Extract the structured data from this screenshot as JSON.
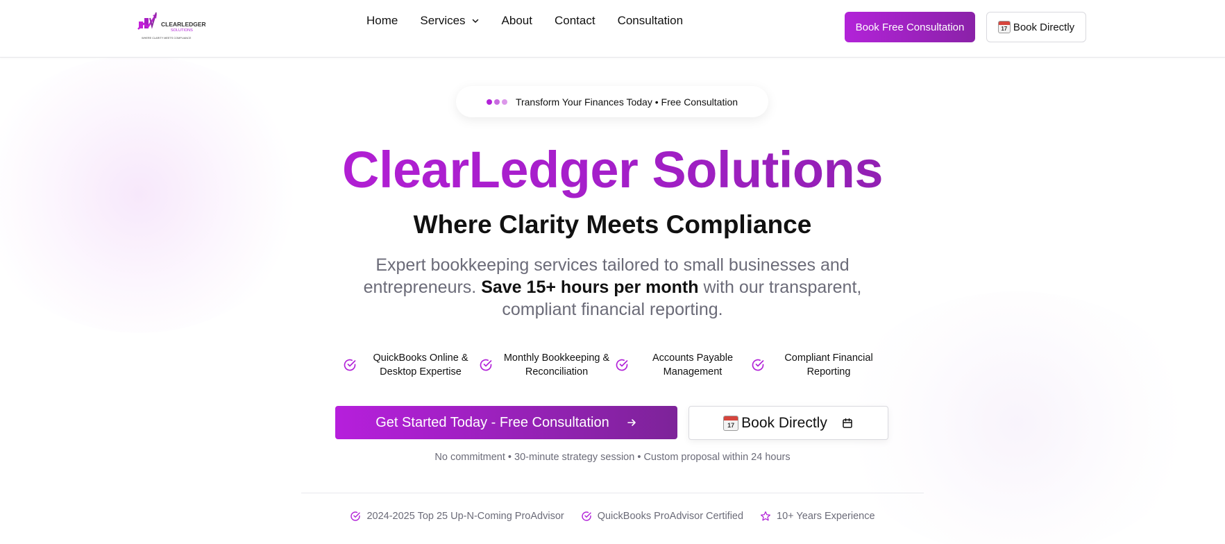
{
  "brand": {
    "logo_name": "CLEARLEDGER",
    "logo_sub": "SOLUTIONS",
    "logo_tagline": "WHERE CLARITY MEETS COMPLIANCE",
    "accent": "#b223d8",
    "accent_dark": "#7b2296"
  },
  "nav": {
    "items": [
      {
        "label": "Home"
      },
      {
        "label": "Services"
      },
      {
        "label": "About"
      },
      {
        "label": "Contact"
      },
      {
        "label": "Consultation"
      }
    ],
    "services_icon": "chevron-down-icon"
  },
  "header_actions": {
    "book_free_label": "Book Free Consultation",
    "book_directly_label": "Book Directly",
    "calendar_emoji_day": "17"
  },
  "pill": {
    "text": "Transform Your Finances Today • Free Consultation",
    "dot_colors": [
      "#b223d8",
      "#c86be0",
      "#dc97ea"
    ]
  },
  "hero": {
    "title": "ClearLedger Solutions",
    "subtitle": "Where Clarity Meets Compliance",
    "desc_part1": "Expert bookkeeping services tailored to small businesses and entrepreneurs.",
    "desc_bold": "Save 15+ hours per month",
    "desc_part2": "with our transparent, compliant financial reporting."
  },
  "features": [
    {
      "label": "QuickBooks Online & Desktop Expertise",
      "icon": "check-circle-icon"
    },
    {
      "label": "Monthly Bookkeeping & Reconciliation",
      "icon": "check-circle-icon"
    },
    {
      "label": "Accounts Payable Management",
      "icon": "check-circle-icon"
    },
    {
      "label": "Compliant Financial Reporting",
      "icon": "check-circle-icon"
    }
  ],
  "cta": {
    "primary_label": "Get Started Today - Free Consultation",
    "primary_icon": "arrow-right-icon",
    "secondary_label": "Book Directly",
    "secondary_icon": "calendar-icon",
    "note": "No commitment • 30-minute strategy session • Custom proposal within 24 hours"
  },
  "trust": [
    {
      "label": "2024-2025 Top 25 Up-N-Coming ProAdvisor",
      "icon": "check-circle-icon"
    },
    {
      "label": "QuickBooks ProAdvisor Certified",
      "icon": "check-circle-icon"
    },
    {
      "label": "10+ Years Experience",
      "icon": "star-icon"
    }
  ]
}
